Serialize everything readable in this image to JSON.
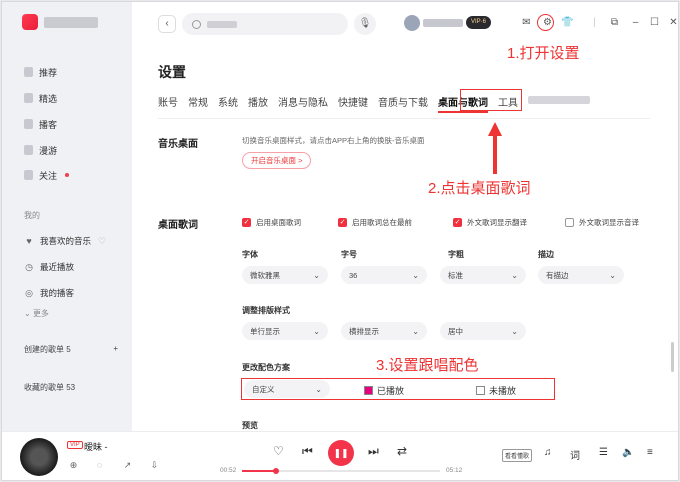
{
  "sidebar": {
    "nav": [
      {
        "label": "推荐",
        "badge": false
      },
      {
        "label": "精选",
        "badge": false
      },
      {
        "label": "播客",
        "badge": false
      },
      {
        "label": "漫游",
        "badge": false
      },
      {
        "label": "关注",
        "badge": true
      }
    ],
    "my_label": "我的",
    "library": [
      {
        "label": "我喜欢的音乐",
        "icon": "heart-icon"
      },
      {
        "label": "最近播放",
        "icon": "clock-icon"
      },
      {
        "label": "我的播客",
        "icon": "podcast-icon"
      }
    ],
    "more_label": "更多",
    "created_playlists": "创建的歌单 5",
    "collected_playlists": "收藏的歌单 53"
  },
  "topbar": {
    "vip_label": "VIP·6"
  },
  "annotations": {
    "step1": "1.打开设置",
    "step2": "2.点击桌面歌词",
    "step3": "3.设置跟唱配色"
  },
  "settings": {
    "title": "设置",
    "tabs": [
      "账号",
      "常规",
      "系统",
      "播放",
      "消息与隐私",
      "快捷键",
      "音质与下载",
      "桌面与歌词",
      "工具"
    ],
    "active_tab": "桌面与歌词",
    "music_desktop": {
      "title": "音乐桌面",
      "description": "切换音乐桌面样式，请点击APP右上角的换肤-音乐桌面",
      "button": "开启音乐桌面 >"
    },
    "desktop_lyrics": {
      "title": "桌面歌词",
      "checkboxes": [
        {
          "label": "启用桌面歌词",
          "checked": true
        },
        {
          "label": "启用歌词总在最前",
          "checked": true
        },
        {
          "label": "外文歌词显示翻译",
          "checked": true
        },
        {
          "label": "外文歌词显示音译",
          "checked": false
        }
      ],
      "font_label": "字体",
      "font_value": "微软雅黑",
      "size_label": "字号",
      "size_value": "36",
      "weight_label": "字粗",
      "weight_value": "标准",
      "stroke_label": "描边",
      "stroke_value": "有描边",
      "layout_label": "调整排版样式",
      "layout_values": [
        "单行显示",
        "横排显示",
        "居中"
      ],
      "color_label": "更改配色方案",
      "color_scheme": "自定义",
      "played_label": "已播放",
      "played_color": "#e4007f",
      "unplayed_label": "未播放",
      "unplayed_color": "#ffffff",
      "preview_label": "预览"
    }
  },
  "player": {
    "vip_tag": "VIP",
    "song_title": "暧昧 -",
    "current_time": "00:52",
    "total_time": "05:12",
    "progress": 0.17,
    "realtime_label": "看看懂歌"
  }
}
